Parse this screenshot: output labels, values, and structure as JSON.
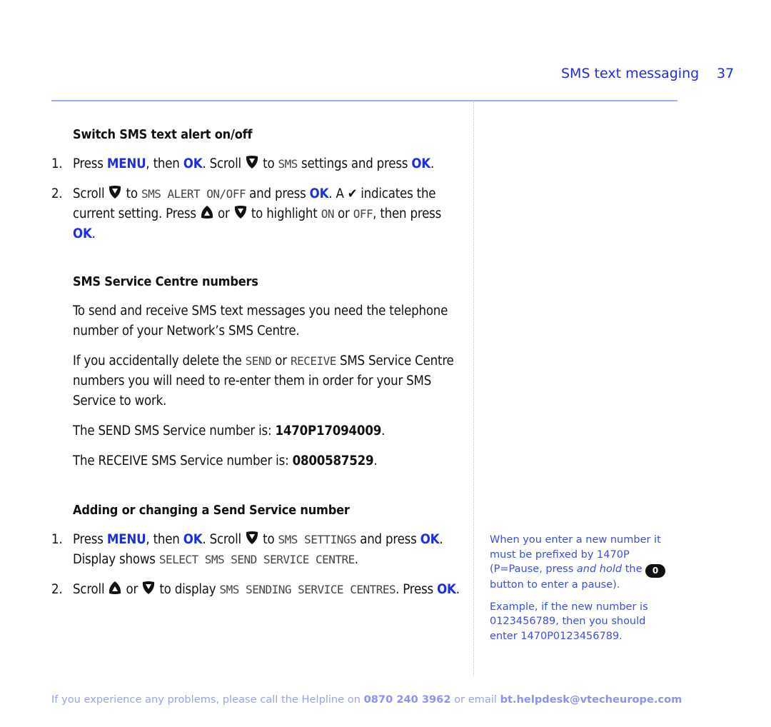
{
  "header": {
    "section_title": "SMS text messaging",
    "page_number": "37"
  },
  "section1": {
    "heading": "Switch SMS text alert on/off",
    "steps": [
      {
        "num": "1.",
        "t1": "Press ",
        "k1": "MENU",
        "t2": ", then ",
        "k2": "OK",
        "t3": ". Scroll ",
        "t4": " to ",
        "lcd1": "SMS",
        "t5": " settings and press ",
        "k3": "OK",
        "t6": "."
      },
      {
        "num": "2.",
        "t1": "Scroll ",
        "t2": " to ",
        "lcd1": "SMS ALERT ON/OFF",
        "t3": " and press ",
        "k1": "OK",
        "t4": ". A ",
        "tick": "✔",
        "t5": " indicates the current setting. Press ",
        "t6": " or ",
        "t7": " to highlight ",
        "lcd2": "ON",
        "t8": " or ",
        "lcd3": "OFF",
        "t9": ", then press ",
        "k2": "OK",
        "t10": "."
      }
    ]
  },
  "section2": {
    "heading": "SMS Service Centre numbers",
    "para1": "To send and receive SMS text messages you need the telephone number of your Network’s SMS Centre.",
    "para2": {
      "t1": "If you accidentally delete the ",
      "lcd1": "SEND",
      "t2": " or ",
      "lcd2": "RECEIVE",
      "t3": " SMS Service Centre numbers you will need to re-enter them in order for your SMS Service to work."
    },
    "send_line": {
      "label": "The SEND SMS Service number is: ",
      "value": "1470P17094009",
      "end": "."
    },
    "receive_line": {
      "label": "The RECEIVE SMS Service number is: ",
      "value": "0800587529",
      "end": "."
    }
  },
  "section3": {
    "heading": "Adding or changing a Send Service number",
    "steps": [
      {
        "num": "1.",
        "t1": "Press ",
        "k1": "MENU",
        "t2": ", then ",
        "k2": "OK",
        "t3": ". Scroll ",
        "t4": " to ",
        "lcd1": "SMS SETTINGS",
        "t5": " and press ",
        "k3": "OK",
        "t6": ". Display shows ",
        "lcd2": "SELECT SMS SEND SERVICE CENTRE",
        "t7": "."
      },
      {
        "num": "2.",
        "t1": "Scroll ",
        "t2": " or ",
        "t3": " to display ",
        "lcd1": "SMS SENDING SERVICE CENTRES",
        "t4": ". Press ",
        "k1": "OK",
        "t5": "."
      }
    ]
  },
  "sidebar_note": {
    "p1_a": "When you enter a new number it must be prefixed by 1470P (P=Pause, press ",
    "p1_em": "and hold",
    "p1_b": " the ",
    "button_label": "0",
    "p1_c": " button to enter a pause).",
    "p2": "Example, if the new number is 0123456789, then you should enter 1470P0123456789."
  },
  "footer": {
    "t1": "If you experience any problems, please call the Helpline on ",
    "phone": "0870 240 3962",
    "t2": " or email ",
    "email": "bt.helpdesk@vtecheurope.com"
  },
  "colors": {
    "accent_blue": "#1b2fe0",
    "rule": "#a4aaf2",
    "footer_text": "#9aa0f0"
  }
}
